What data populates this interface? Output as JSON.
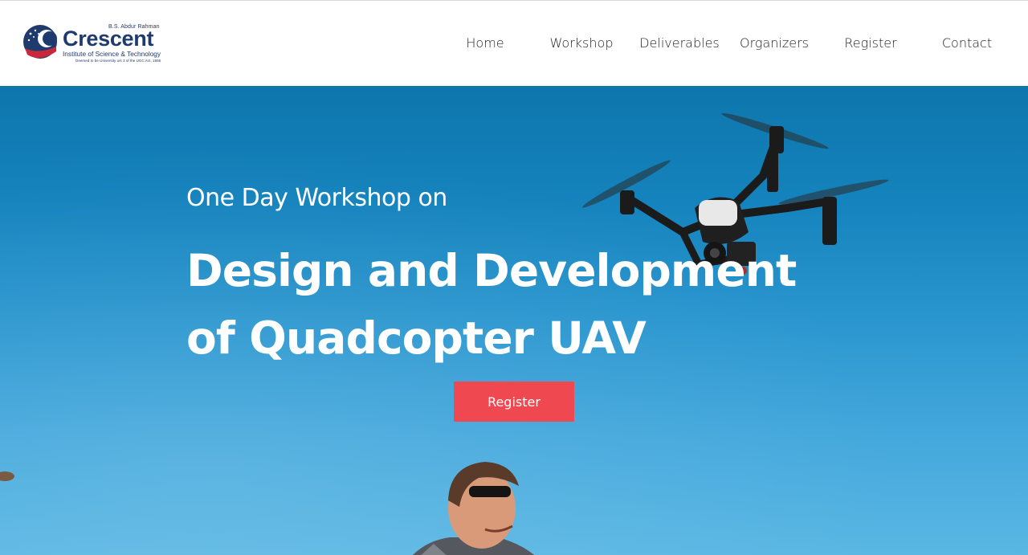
{
  "logo": {
    "sup": "B.S. Abdur Rahman",
    "name": "Crescent",
    "line1": "Institute of Science & Technology",
    "line2": "Deemed to be University u/s 3 of the UGC Act, 1956"
  },
  "nav": {
    "items": [
      "Home",
      "Workshop",
      "Deliverables",
      "Organizers",
      "Register",
      "Contact"
    ]
  },
  "hero": {
    "subtitle": "One Day Workshop on",
    "title_line1": "Design and Development",
    "title_line2": "of Quadcopter UAV",
    "register_label": "Register"
  },
  "colors": {
    "brand_navy": "#1f3a6e",
    "brand_red": "#c8283a",
    "cta_red": "#ef4850",
    "sky": "#2a96cf"
  },
  "icons": [
    "crescent-logo-icon",
    "drone-image",
    "person-image"
  ]
}
